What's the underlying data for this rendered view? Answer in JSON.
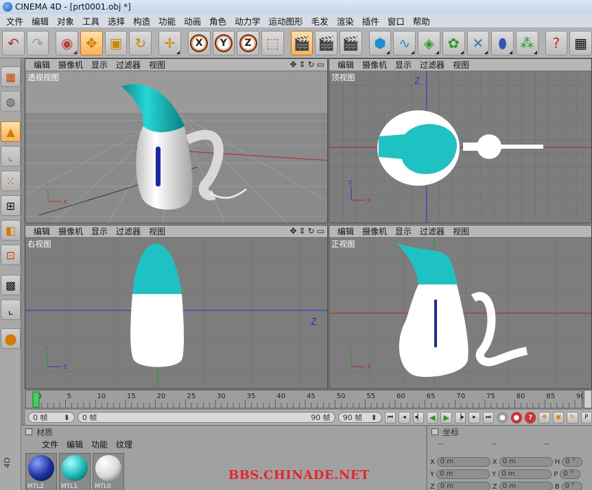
{
  "window": {
    "title": "CINEMA 4D - [prt0001.obj *]"
  },
  "menubar": [
    "文件",
    "编辑",
    "对象",
    "工具",
    "选择",
    "构造",
    "功能",
    "动画",
    "角色",
    "动力学",
    "运动图形",
    "毛发",
    "渲染",
    "插件",
    "窗口",
    "帮助"
  ],
  "viewport_menu": [
    "编辑",
    "摄像机",
    "显示",
    "过滤器",
    "视图"
  ],
  "viewports": {
    "perspective": {
      "title": "透视视图"
    },
    "top": {
      "title": "顶视图"
    },
    "right": {
      "title": "右视图"
    },
    "front": {
      "title": "正视图"
    }
  },
  "axis_labels": {
    "x": "X",
    "y": "Y",
    "z": "Z"
  },
  "timeline": {
    "ticks": [
      "0",
      "5",
      "10",
      "15",
      "20",
      "25",
      "30",
      "35",
      "40",
      "45",
      "50",
      "55",
      "60",
      "65",
      "70",
      "75",
      "80",
      "85",
      "90"
    ],
    "current_frame": 0
  },
  "transport": {
    "current": "0 帧",
    "range_start": "0 帧",
    "range_end": "90 帧",
    "max": "90 帧"
  },
  "materials": {
    "title": "材质",
    "menu": [
      "文件",
      "编辑",
      "功能",
      "纹理"
    ],
    "items": [
      {
        "label": "MTL2",
        "color": "#1a2f9a"
      },
      {
        "label": "MTL1",
        "color": "#17b5b5"
      },
      {
        "label": "MTL0",
        "color": "#e6e6e6"
      }
    ]
  },
  "coordinates": {
    "title": "坐标",
    "header_dashes": [
      "--",
      "--",
      "--"
    ],
    "rows": [
      {
        "a": "X",
        "av": "0 m",
        "b": "X",
        "bv": "0 m",
        "c": "H",
        "cv": "0 °"
      },
      {
        "a": "Y",
        "av": "0 m",
        "b": "Y",
        "bv": "0 m",
        "c": "P",
        "cv": "0 °"
      },
      {
        "a": "Z",
        "av": "0 m",
        "b": "Z",
        "bv": "0 m",
        "c": "B",
        "cv": "0 °"
      }
    ]
  },
  "watermark": "BBS.CHINADE.NET",
  "colors": {
    "cyan": "#1ec2c2",
    "handle": "#1a2aa8",
    "axis_red": "#c02020",
    "axis_blue": "#3030d0",
    "axis_green": "#20a020"
  }
}
